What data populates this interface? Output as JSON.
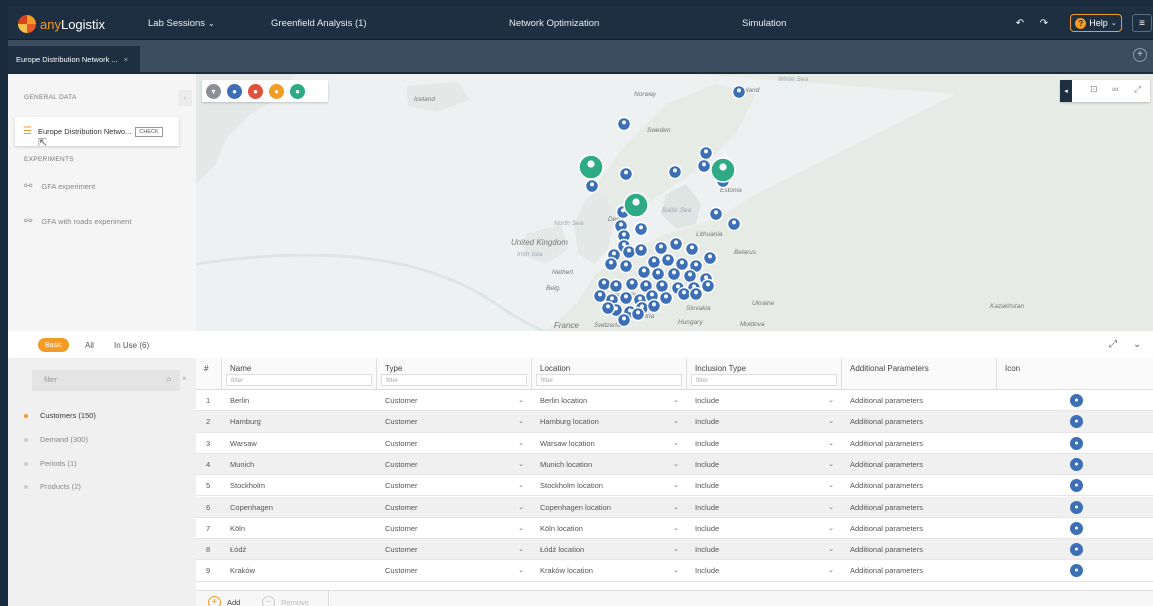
{
  "app": {
    "brand_prefix": "any",
    "brand_suffix": "Logistix"
  },
  "nav": {
    "lab_sessions": "Lab Sessions",
    "greenfield": "Greenfield Analysis (1)",
    "network_opt": "Network Optimization",
    "simulation": "Simulation",
    "help": "Help"
  },
  "tab": {
    "title": "Europe Distribution Network ...",
    "close": "×"
  },
  "sidebar": {
    "general_data": "GENERAL DATA",
    "scenario_name": "Europe Distribution Netwo...",
    "check": "CHECK",
    "experiments": "EXPERIMENTS",
    "experiment_items": [
      "GFA experiment",
      "GFA with roads experiment"
    ]
  },
  "map": {
    "labels": [
      "Iceland",
      "Norway",
      "Sweden",
      "Finland",
      "Estonia",
      "Baltic Sea",
      "North Sea",
      "United Kingdom",
      "Lithuania",
      "Belarus",
      "Ukraine",
      "Czech Repub.",
      "Austria",
      "France",
      "Switzerland",
      "Slovakia",
      "Hungary",
      "Moldova",
      "Kazakhstan",
      "White Sea",
      "Netherl.",
      "Belg.",
      "Irish Sea",
      "Den"
    ],
    "toolbar_colors": [
      "#8c9096",
      "#3d6fb6",
      "#e0513b",
      "#f29b25",
      "#2eaa84"
    ]
  },
  "panel": {
    "tabs": [
      "Basic",
      "All",
      "In Use (6)"
    ]
  },
  "left_list": {
    "filter_placeholder": "filter",
    "items": [
      "Customers (150)",
      "Demand (300)",
      "Periods (1)",
      "Products (2)"
    ]
  },
  "grid": {
    "columns": [
      "#",
      "Name",
      "Type",
      "Location",
      "Inclusion Type",
      "Additional Parameters",
      "Icon"
    ],
    "filter_placeholder": "filter",
    "rows": [
      {
        "n": "1",
        "name": "Berlin",
        "type": "Customer",
        "location": "Berlin location",
        "inclusion": "Include",
        "params": "Additional parameters"
      },
      {
        "n": "2",
        "name": "Hamburg",
        "type": "Customer",
        "location": "Hamburg location",
        "inclusion": "Include",
        "params": "Additional parameters"
      },
      {
        "n": "3",
        "name": "Warsaw",
        "type": "Customer",
        "location": "Warsaw location",
        "inclusion": "Include",
        "params": "Additional parameters"
      },
      {
        "n": "4",
        "name": "Munich",
        "type": "Customer",
        "location": "Munich location",
        "inclusion": "Include",
        "params": "Additional parameters"
      },
      {
        "n": "5",
        "name": "Stockholm",
        "type": "Customer",
        "location": "Stockholm location",
        "inclusion": "Include",
        "params": "Additional parameters"
      },
      {
        "n": "6",
        "name": "Copenhagen",
        "type": "Customer",
        "location": "Copenhagen location",
        "inclusion": "Include",
        "params": "Additional parameters"
      },
      {
        "n": "7",
        "name": "Köln",
        "type": "Customer",
        "location": "Köln location",
        "inclusion": "Include",
        "params": "Additional parameters"
      },
      {
        "n": "8",
        "name": "Łódź",
        "type": "Customer",
        "location": "Łódź location",
        "inclusion": "Include",
        "params": "Additional parameters"
      },
      {
        "n": "9",
        "name": "Kraków",
        "type": "Customer",
        "location": "Kraków location",
        "inclusion": "Include",
        "params": "Additional parameters"
      }
    ]
  },
  "footer": {
    "add": "Add",
    "remove": "Remove"
  },
  "colors": {
    "accent": "#f29b25",
    "header_bg": "#1e2f42",
    "customer_pin": "#3d6fb6",
    "warehouse_pin": "#2eaa84"
  }
}
